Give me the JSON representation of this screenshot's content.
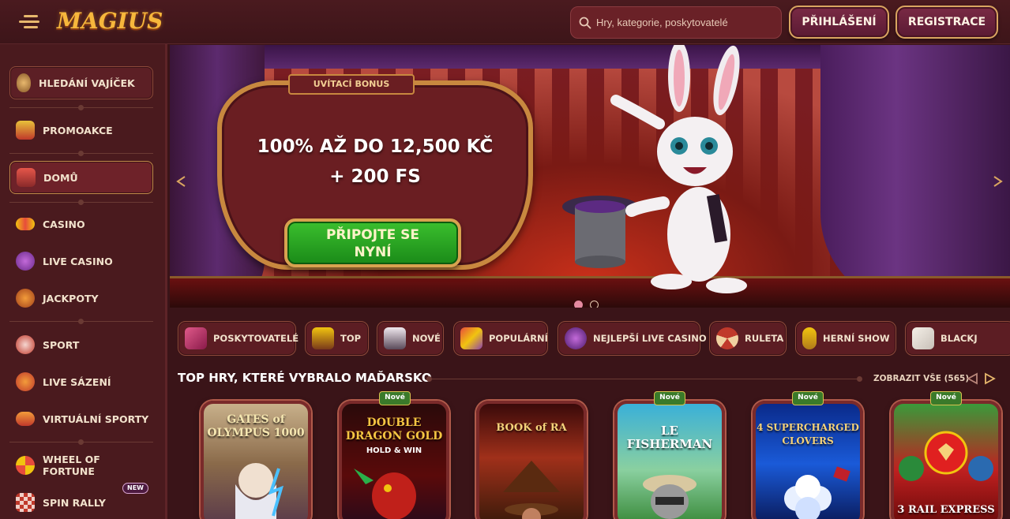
{
  "header": {
    "logo": "MAGIUS",
    "search_placeholder": "Hry, kategorie, poskytovatelé",
    "login_label": "PŘIHLÁŠENÍ",
    "register_label": "REGISTRACE"
  },
  "sidebar": {
    "items": [
      {
        "label": "HLEDÁNÍ VAJÍČEK",
        "icon": "egg-icon"
      },
      {
        "label": "PROMOAKCE",
        "icon": "gift-icon"
      },
      {
        "label": "DOMŮ",
        "icon": "home-icon"
      },
      {
        "label": "CASINO",
        "icon": "slot-icon"
      },
      {
        "label": "LIVE CASINO",
        "icon": "live-casino-icon"
      },
      {
        "label": "JACKPOTY",
        "icon": "jackpot-icon"
      },
      {
        "label": "SPORT",
        "icon": "trophy-icon"
      },
      {
        "label": "LIVE SÁZENÍ",
        "icon": "live-bet-icon"
      },
      {
        "label": "VIRTUÁLNÍ SPORTY",
        "icon": "gamepad-icon"
      },
      {
        "label": "WHEEL OF FORTUNE",
        "icon": "wheel-icon"
      },
      {
        "label": "SPIN RALLY",
        "icon": "flag-icon",
        "badge": "NEW"
      }
    ]
  },
  "hero": {
    "tag": "UVÍTACÍ BONUS",
    "line1": "100% AŽ DO 12,500 KČ",
    "line2": "+ 200 FS",
    "cta_line1": "PŘIPOJTE SE",
    "cta_line2": "NYNÍ"
  },
  "categories": [
    "POSKYTOVATELÉ",
    "TOP",
    "NOVÉ",
    "POPULÁRNÍ",
    "NEJLEPŠÍ LIVE CASINO",
    "RULETA",
    "HERNÍ SHOW",
    "BLACKJ"
  ],
  "section": {
    "title": "TOP HRY, KTERÉ VYBRALO MAĎARSKO",
    "view_all": "ZOBRAZIT VŠE (565)"
  },
  "games": [
    {
      "title": "GATES of OLYMPUS 1000",
      "sub": "",
      "badge": ""
    },
    {
      "title": "DOUBLE DRAGON GOLD",
      "sub": "HOLD & WIN",
      "badge": "Nové"
    },
    {
      "title": "BOOK of RA",
      "sub": "",
      "badge": ""
    },
    {
      "title": "LE FISHERMAN",
      "sub": "",
      "badge": "Nové"
    },
    {
      "title": "4 SUPERCHARGED CLOVERS",
      "sub": "",
      "badge": "Nové"
    },
    {
      "title": "3 RAIL EXPRESS",
      "sub": "",
      "badge": "Nové"
    }
  ],
  "colors": {
    "background": "#3a1418",
    "accent_gold": "#d9a560",
    "cta_green": "#2aa722"
  }
}
